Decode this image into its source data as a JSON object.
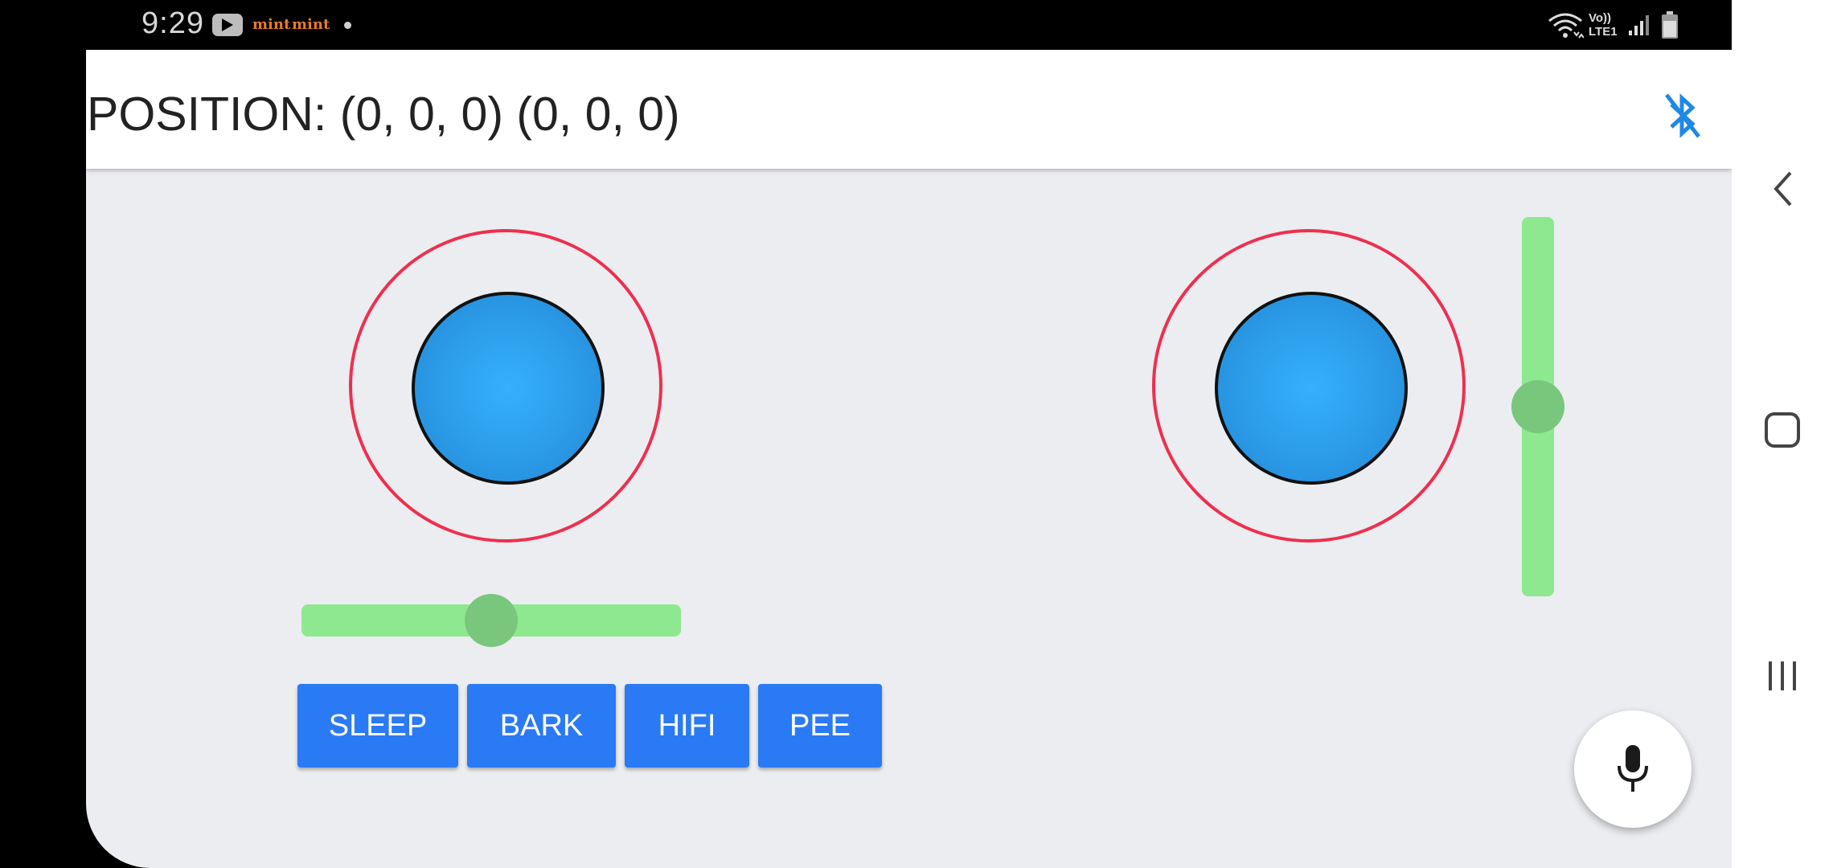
{
  "status_bar": {
    "time": "9:29",
    "notification_apps": [
      "mint",
      "mint"
    ],
    "network_label": "Vo)) LTE1",
    "icons": [
      "youtube-icon",
      "wifi-icon",
      "signal-icon",
      "battery-icon"
    ]
  },
  "app_bar": {
    "position_text": "POSITION: (0, 0, 0) (0, 0, 0)",
    "bluetooth_status": "disconnected",
    "accent_color": "#1e88e5"
  },
  "controls": {
    "left_joystick": {
      "x": 0,
      "y": 0
    },
    "right_joystick": {
      "x": 0,
      "y": 0
    },
    "horizontal_slider_fraction": 0.5,
    "vertical_slider_fraction": 0.5
  },
  "buttons": [
    {
      "label": "SLEEP"
    },
    {
      "label": "BARK"
    },
    {
      "label": "HIFI"
    },
    {
      "label": "PEE"
    }
  ],
  "colors": {
    "button": "#2b7af5",
    "ring": "#ee2f4f",
    "knob": "#2b9be7",
    "track": "#8ee88f",
    "thumb": "#79c67d",
    "background": "#ebedf0"
  },
  "navigation": [
    "back-icon",
    "home-icon",
    "recents-icon"
  ]
}
